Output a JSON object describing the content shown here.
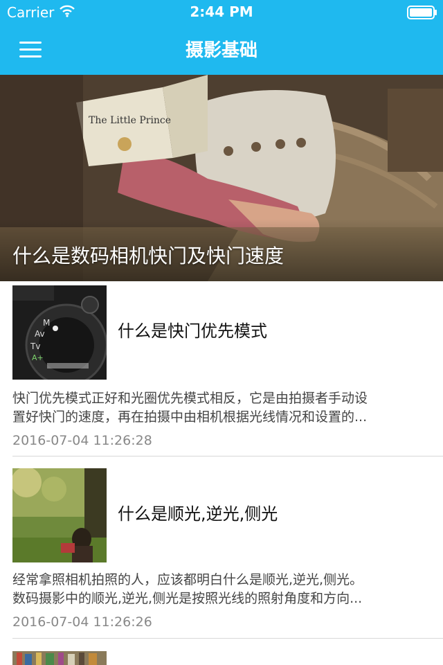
{
  "status_bar": {
    "carrier": "Carrier",
    "time": "2:44 PM",
    "icons": [
      "wifi-icon",
      "battery-icon"
    ]
  },
  "nav": {
    "title": "摄影基础",
    "menu_icon": "hamburger-menu-icon"
  },
  "colors": {
    "accent": "#1fb9ef",
    "title_text": "#111111",
    "summary_text": "#444444",
    "date_text": "#888888"
  },
  "banner": {
    "title": "什么是数码相机快门及快门速度"
  },
  "articles": [
    {
      "title": "什么是快门优先模式",
      "summary_line1": "快门优先模式正好和光圈优先模式相反，它是由拍摄者手动设",
      "summary_line2": "置好快门的速度，再在拍摄中由相机根据光线情况和设置的...",
      "date": "2016-07-04 11:26:28"
    },
    {
      "title": "什么是顺光,逆光,侧光",
      "summary_line1": "经常拿照相机拍照的人，应该都明白什么是顺光,逆光,侧光。",
      "summary_line2": "数码摄影中的顺光,逆光,侧光是按照光线的照射角度和方向...",
      "date": "2016-07-04 11:26:26"
    }
  ]
}
